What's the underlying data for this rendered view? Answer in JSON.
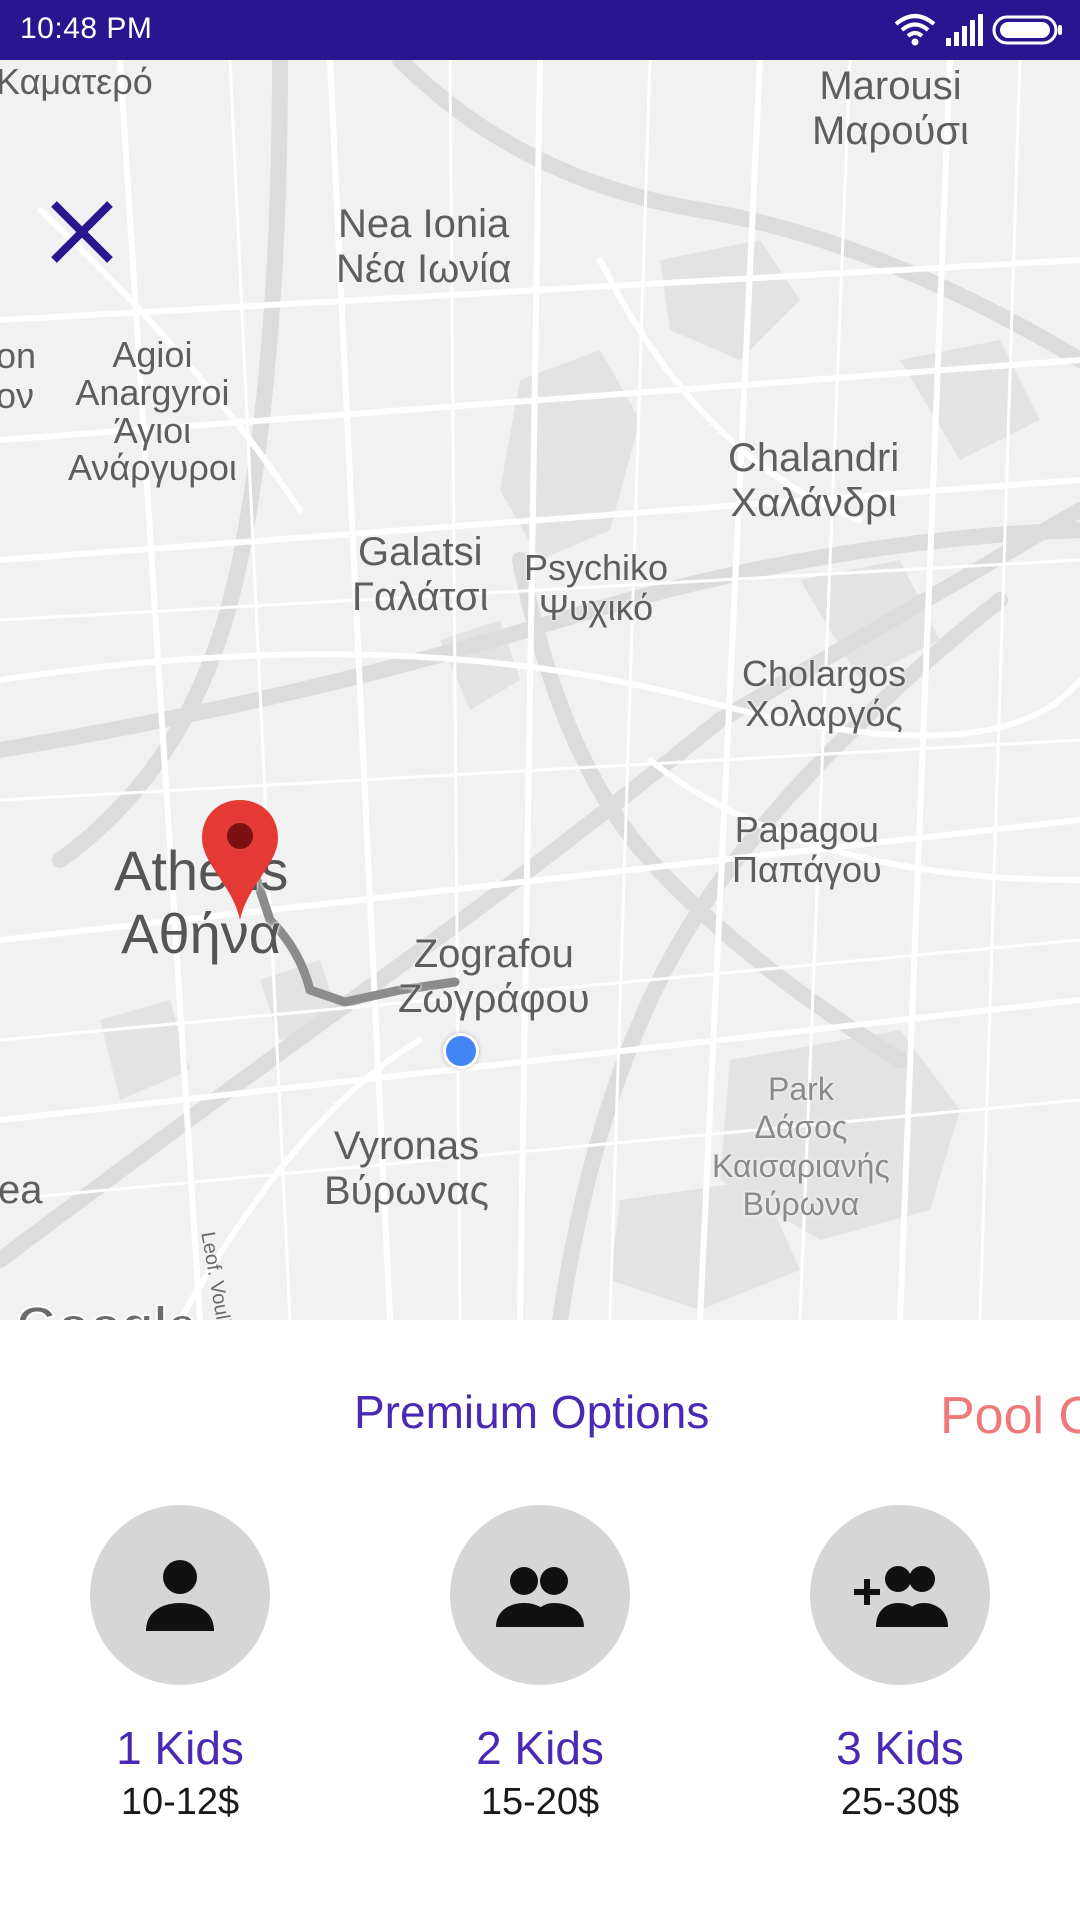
{
  "status_bar": {
    "time": "10:48 PM",
    "icons": [
      "wifi-icon",
      "signal-icon",
      "battery-icon"
    ],
    "background_color": "#2a1591"
  },
  "map": {
    "close_icon": "close-icon",
    "places": {
      "kamatero": "Καματερό",
      "marousi_en": "Marousi",
      "marousi_gr": "Μαρούσι",
      "nea_ionia_en": "Nea Ionia",
      "nea_ionia_gr": "Νέα Ιωνία",
      "agioi_1": "Agioi",
      "agioi_2": "Anargyroi",
      "agioi_3": "Άγιοι",
      "agioi_4": "Ανάργυροι",
      "left_partial_1": "on",
      "left_partial_2": "ον",
      "chalandri_en": "Chalandri",
      "chalandri_gr": "Χαλάνδρι",
      "galatsi_en": "Galatsi",
      "galatsi_gr": "Γαλάτσι",
      "psychiko_en": "Psychiko",
      "psychiko_gr": "Ψυχικό",
      "cholargos_en": "Cholargos",
      "cholargos_gr": "Χολαργός",
      "papagou_en": "Papagou",
      "papagou_gr": "Παπάγου",
      "athens_en": "Athens",
      "athens_gr": "Αθήνα",
      "zografou_en": "Zografou",
      "zografou_gr": "Ζωγράφου",
      "park_1": "Park",
      "park_2": "Δάσος",
      "park_3": "Καισαριανής",
      "park_4": "Βύρωνα",
      "vyronas_en": "Vyronas",
      "vyronas_gr": "Βύρωνας",
      "bottom_left_partial": "ea"
    },
    "street_label": "Leof. Vouliagmenis",
    "logo_text": "Google",
    "pin_color": "#e53935",
    "location_dot_color": "#4285f4",
    "route_color": "#8c8c8c"
  },
  "options": {
    "tabs": {
      "premium": "Premium Options",
      "pool": "Pool Options"
    },
    "items": [
      {
        "icon": "person-icon",
        "title": "1 Kids",
        "price": "10-12$"
      },
      {
        "icon": "people-icon",
        "title": "2 Kids",
        "price": "15-20$"
      },
      {
        "icon": "group-add-icon",
        "title": "3 Kids",
        "price": "25-30$"
      }
    ],
    "accent_color": "#4a2ab5",
    "pool_color": "#f07878"
  }
}
